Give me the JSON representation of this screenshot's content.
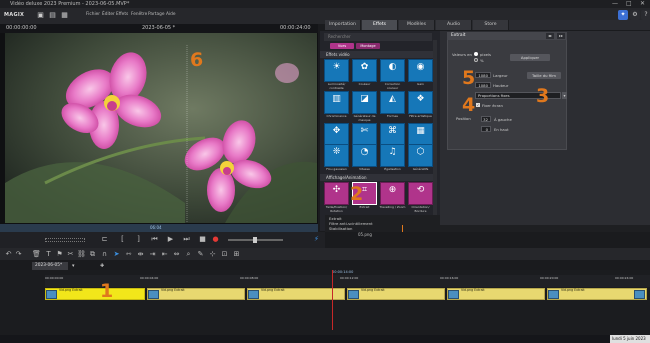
{
  "window": {
    "title": "Vidéo deluxe 2023 Premium - 2023-06-05.MVP*",
    "min": "—",
    "max": "□",
    "close": "✕"
  },
  "menu": {
    "logo": "MAGIX",
    "items": [
      "Fichier",
      "Éditer",
      "Effets",
      "Fenêtre",
      "Partage",
      "Aide"
    ]
  },
  "preview": {
    "timecode_left": "00:00:00:00",
    "title": "2023-06-05 *",
    "timecode_right": "00:00:24:00",
    "progress_label": "06:04"
  },
  "tabs": [
    "Importation",
    "Effets",
    "Modèles",
    "Audio",
    "Store"
  ],
  "active_tab": "Effets",
  "effects_panel": {
    "search_placeholder": "Rechercher",
    "pills": [
      "Vues",
      "Montage"
    ],
    "category_video": "Effets vidéo",
    "tiles_row1": [
      "Luminosité/ contraste",
      "Couleur",
      "Correction couleur",
      "Gain"
    ],
    "tiles_row2": [
      "Chrominance",
      "Générateur de masque",
      "Formes",
      "Filtre artistique"
    ],
    "tiles_row3": [
      "VEGAS Video Stabilization",
      "Bullet",
      "Distorsion",
      "Retrait"
    ],
    "tiles_row4": [
      "Flou gaussien",
      "Vitesse",
      "Égalisation",
      "Génératifs"
    ],
    "category_motion": "Affichage/Animation",
    "motion_tiles": [
      "Taille/Position/ Rotation",
      "Extrait",
      "Travelling / Zoom",
      "Orientation/ Bordure"
    ]
  },
  "extrait_panel": {
    "title": "Extrait",
    "values_label": "Valeurs en",
    "unit_label": "pixels",
    "unit_alt": "%",
    "apply_label": "Appliquer",
    "width_value": "1080",
    "width_label": "Largeur",
    "height_value": "1080",
    "height_label": "Hauteur",
    "fit_button": "Taille du film",
    "ratio_select": "Proportions fixes",
    "fixed_label": "Fixer écran",
    "position_label": "Position",
    "pos_x_value": "32",
    "pos_x_label": "À gauche",
    "pos_y_value": "0",
    "pos_y_label": "En haut"
  },
  "overlays": {
    "n1": "1",
    "n2": "2",
    "n3": "3",
    "n4": "4",
    "n5": "5",
    "n6": "6"
  },
  "timeline": {
    "project_tab": "2023-06-05*",
    "playhead_time": "00:00:14:00",
    "clip_labels": [
      "Vid.png  Extrait",
      "Vid.png  Extrait",
      "Vid.png  Extrait",
      "Vid.png  Extrait",
      "Vid.png  Extrait",
      "Vid.png  Extrait"
    ],
    "ruler_labels": [
      "00:00:00:00",
      "00:00:04:00",
      "00:00:08:00",
      "00:00:12:00",
      "00:00:16:00",
      "00:00:20:00",
      "00:00:24:00"
    ]
  },
  "list_rows": [
    "Extrait",
    "Filtre anti-scintillement",
    "Stabilisation"
  ],
  "list_file": "05.png",
  "status": {
    "date": "lundi 5 juin 2023"
  },
  "colors": {
    "accent_blue": "#1677b8",
    "accent_purple": "#b0348b",
    "clip_yellow": "#f2e61a",
    "overlay_orange": "#e0781d"
  }
}
